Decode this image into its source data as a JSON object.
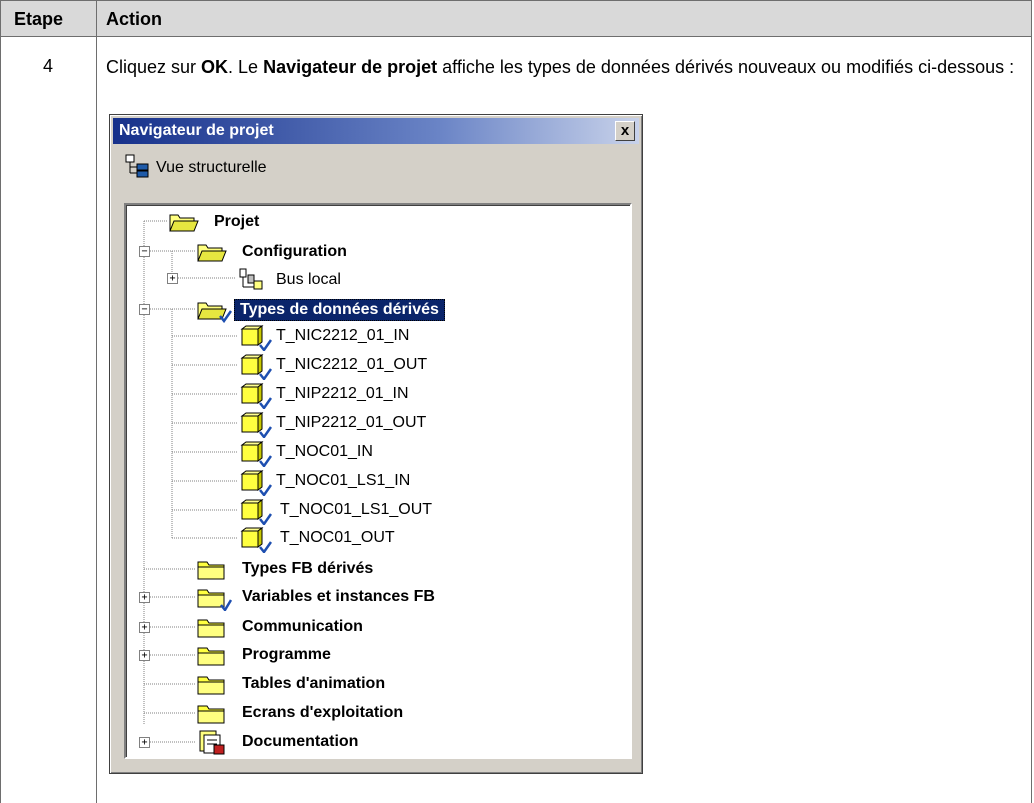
{
  "table": {
    "header_step": "Etape",
    "header_action": "Action",
    "step_number": "4",
    "instruction_parts": [
      "Cliquez sur ",
      "OK",
      ". Le ",
      "Navigateur de projet",
      " affiche les types de données dérivés nouveaux ou modifiés ci-dessous :"
    ]
  },
  "window": {
    "title": "Navigateur de projet",
    "close_glyph": "x",
    "view_label": "Vue structurelle"
  },
  "tree": {
    "root": "Projet",
    "configuration": "Configuration",
    "bus_local": "Bus local",
    "ddt_folder": "Types de données dérivés",
    "ddt_items": [
      "T_NIC2212_01_IN",
      "T_NIC2212_01_OUT",
      "T_NIP2212_01_IN",
      "T_NIP2212_01_OUT",
      "T_NOC01_IN",
      "T_NOC01_LS1_IN",
      "T_NOC01_LS1_OUT",
      "T_NOC01_OUT"
    ],
    "fb_types": "Types FB dérivés",
    "variables": "Variables et instances FB",
    "communication": "Communication",
    "programme": "Programme",
    "tables": "Tables d'animation",
    "ecrans": "Ecrans d'exploitation",
    "documentation": "Documentation",
    "expand_plus": "+",
    "expand_minus": "−"
  },
  "colors": {
    "header_bg": "#d9d9d9",
    "selection_bg": "#0a246a",
    "folder_yellow": "#ffff80",
    "title_blue": "#16308a"
  }
}
